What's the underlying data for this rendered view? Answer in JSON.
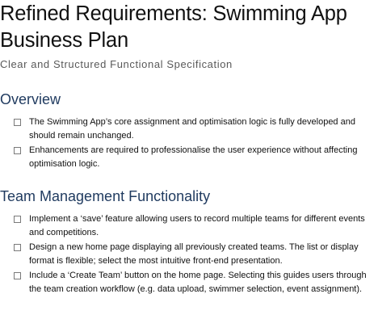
{
  "document": {
    "title": "Refined Requirements: Swimming App Business Plan",
    "subtitle": "Clear and Structured Functional Specification"
  },
  "sections": {
    "overview": {
      "heading": "Overview",
      "items": [
        "The Swimming App’s core assignment and optimisation logic is fully developed and should remain unchanged.",
        "Enhancements are required to professionalise the user experience without affecting optimisation logic."
      ]
    },
    "team_management": {
      "heading": "Team Management Functionality",
      "items": [
        "Implement a ‘save’ feature allowing users to record multiple teams for different events and competitions.",
        "Design a new home page displaying all previously created teams. The list or display format is flexible; select the most intuitive front-end presentation.",
        "Include a ‘Create Team’ button on the home page. Selecting this guides users through the team creation workflow (e.g. data upload, swimmer selection, event assignment)."
      ]
    }
  },
  "colors": {
    "heading": "#1f3a5f",
    "subtitle": "#595959",
    "text": "#111111",
    "checkbox_border": "#7a7a7a"
  },
  "icons": {
    "bullet": "checkbox-icon"
  }
}
